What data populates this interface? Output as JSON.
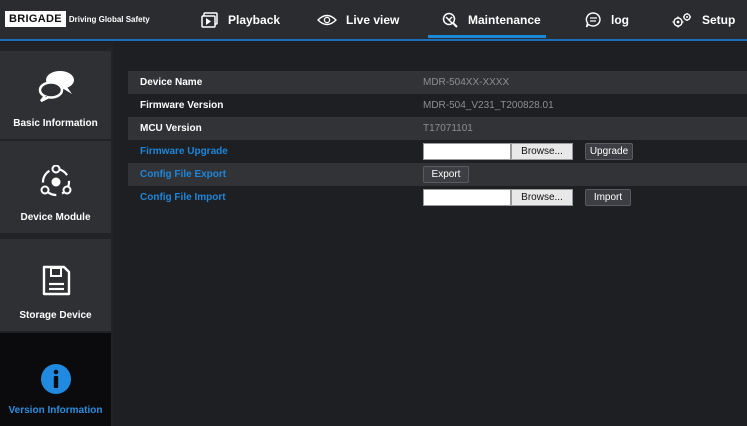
{
  "brand": {
    "logo": "BRIGADE",
    "tagline": "Driving Global Safety"
  },
  "nav": {
    "items": [
      {
        "label": "Playback",
        "icon": "playback-icon"
      },
      {
        "label": "Live view",
        "icon": "eye-icon"
      },
      {
        "label": "Maintenance",
        "icon": "maintenance-icon",
        "active": true
      },
      {
        "label": "log",
        "icon": "log-icon"
      },
      {
        "label": "Setup",
        "icon": "gears-icon"
      }
    ],
    "accent_color": "#1b8ad6"
  },
  "sidebar": {
    "items": [
      {
        "label": "Basic Information",
        "icon": "speech-bubbles-icon"
      },
      {
        "label": "Device Module",
        "icon": "module-icon"
      },
      {
        "label": "Storage Device",
        "icon": "floppy-disk-icon"
      },
      {
        "label": "Version Information",
        "icon": "info-icon",
        "active": true
      }
    ],
    "active_color": "#2a8fe0"
  },
  "main": {
    "rows": [
      {
        "key": "Device Name",
        "value": "MDR-504XX-XXXX"
      },
      {
        "key": "Firmware Version",
        "value": "MDR-504_V231_T200828.01"
      },
      {
        "key": "MCU Version",
        "value": "T17071101"
      },
      {
        "key": "Firmware Upgrade",
        "browse": "Browse...",
        "action": "Upgrade"
      },
      {
        "key": "Config File Export",
        "action": "Export"
      },
      {
        "key": "Config File Import",
        "browse": "Browse...",
        "action": "Import"
      }
    ]
  }
}
